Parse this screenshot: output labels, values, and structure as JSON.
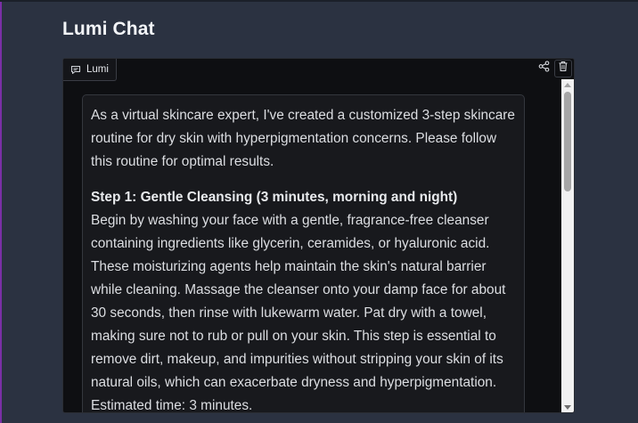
{
  "app": {
    "title": "Lumi Chat"
  },
  "chat": {
    "label": "Lumi",
    "label_icon": "chat-bubble-icon",
    "share_icon": "share-icon",
    "delete_icon": "trash-icon"
  },
  "message": {
    "intro": "As a virtual skincare expert, I've created a customized 3-step skincare routine for dry skin with hyperpigmentation concerns. Please follow this routine for optimal results.",
    "step1": {
      "heading": "Step 1: Gentle Cleansing (3 minutes, morning and night)",
      "body": "Begin by washing your face with a gentle, fragrance-free cleanser containing ingredients like glycerin, ceramides, or hyaluronic acid. These moisturizing agents help maintain the skin's natural barrier while cleaning. Massage the cleanser onto your damp face for about 30 seconds, then rinse with lukewarm water. Pat dry with a towel, making sure not to rub or pull on your skin. This step is essential to remove dirt, makeup, and impurities without stripping your skin of its natural oils, which can exacerbate dryness and hyperpigmentation. Estimated time: 3 minutes."
    }
  },
  "colors": {
    "page_background": "#2b3241",
    "panel_background": "#0e0f12",
    "bubble_background": "#18191d",
    "text": "#dcdee2"
  }
}
